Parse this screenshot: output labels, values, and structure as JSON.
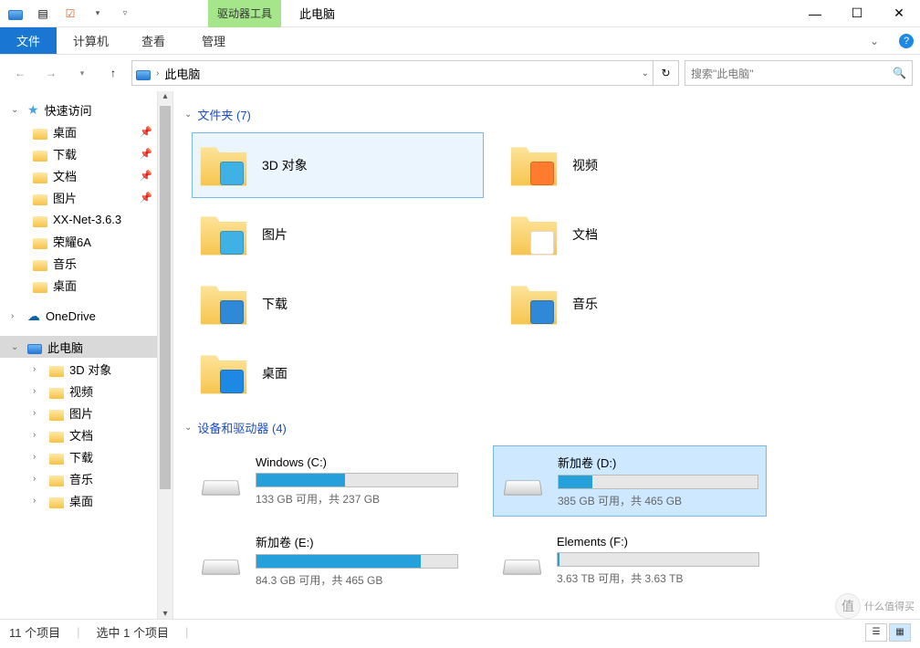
{
  "title": "此电脑",
  "contextual_tab": "驱动器工具",
  "ribbon": {
    "file": "文件",
    "computer": "计算机",
    "view": "查看",
    "manage": "管理"
  },
  "nav": {
    "location": "此电脑",
    "search_placeholder": "搜索\"此电脑\""
  },
  "sidebar": {
    "quick_access": "快速访问",
    "qa_items": [
      {
        "label": "桌面",
        "pinned": true
      },
      {
        "label": "下载",
        "pinned": true
      },
      {
        "label": "文档",
        "pinned": true
      },
      {
        "label": "图片",
        "pinned": true
      },
      {
        "label": "XX-Net-3.6.3",
        "pinned": false
      },
      {
        "label": "荣耀6A",
        "pinned": false
      },
      {
        "label": "音乐",
        "pinned": false
      },
      {
        "label": "桌面",
        "pinned": false
      }
    ],
    "onedrive": "OneDrive",
    "this_pc": "此电脑",
    "pc_items": [
      {
        "label": "3D 对象"
      },
      {
        "label": "视频"
      },
      {
        "label": "图片"
      },
      {
        "label": "文档"
      },
      {
        "label": "下载"
      },
      {
        "label": "音乐"
      },
      {
        "label": "桌面"
      }
    ]
  },
  "groups": {
    "folders_header": "文件夹 (7)",
    "folders": [
      {
        "label": "3D 对象",
        "selected": true
      },
      {
        "label": "视频"
      },
      {
        "label": "图片"
      },
      {
        "label": "文档"
      },
      {
        "label": "下载"
      },
      {
        "label": "音乐"
      },
      {
        "label": "桌面"
      }
    ],
    "drives_header": "设备和驱动器 (4)",
    "drives": [
      {
        "name": "Windows (C:)",
        "stat": "133 GB 可用，共 237 GB",
        "fill": 44,
        "selected": false
      },
      {
        "name": "新加卷 (D:)",
        "stat": "385 GB 可用，共 465 GB",
        "fill": 17,
        "selected": true
      },
      {
        "name": "新加卷 (E:)",
        "stat": "84.3 GB 可用，共 465 GB",
        "fill": 82,
        "selected": false
      },
      {
        "name": "Elements (F:)",
        "stat": "3.63 TB 可用，共 3.63 TB",
        "fill": 1,
        "selected": false
      }
    ]
  },
  "status": {
    "count": "11 个项目",
    "selection": "选中 1 个项目"
  },
  "watermark": "什么值得买"
}
